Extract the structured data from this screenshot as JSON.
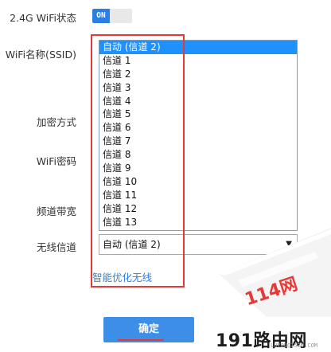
{
  "form": {
    "wifi_status_label": "2.4G WiFi状态",
    "toggle_label": "ON",
    "ssid_label": "WiFi名称(SSID)",
    "encryption_label": "加密方式",
    "password_label": "WiFi密码",
    "bandwidth_label": "频道带宽",
    "channel_label": "无线信道"
  },
  "channel_dropdown": {
    "options": [
      "自动 (信道 2)",
      "信道 1",
      "信道 2",
      "信道 3",
      "信道 4",
      "信道 5",
      "信道 6",
      "信道 7",
      "信道 8",
      "信道 9",
      "信道 10",
      "信道 11",
      "信道 12",
      "信道 13"
    ],
    "selected_index": 0
  },
  "channel_select": {
    "value": "自动 (信道 2)",
    "arrow_icon": "▼"
  },
  "smart_optimize_link": "智能优化无线",
  "confirm_button": "确定",
  "watermark": {
    "stamp_text": "114网",
    "site_text": "191路由网",
    "site_url": "LUYOUQI520.COM"
  },
  "colors": {
    "accent": "#2a7fe0",
    "highlight_red": "#e53935",
    "selected_option": "#1e90ff"
  }
}
